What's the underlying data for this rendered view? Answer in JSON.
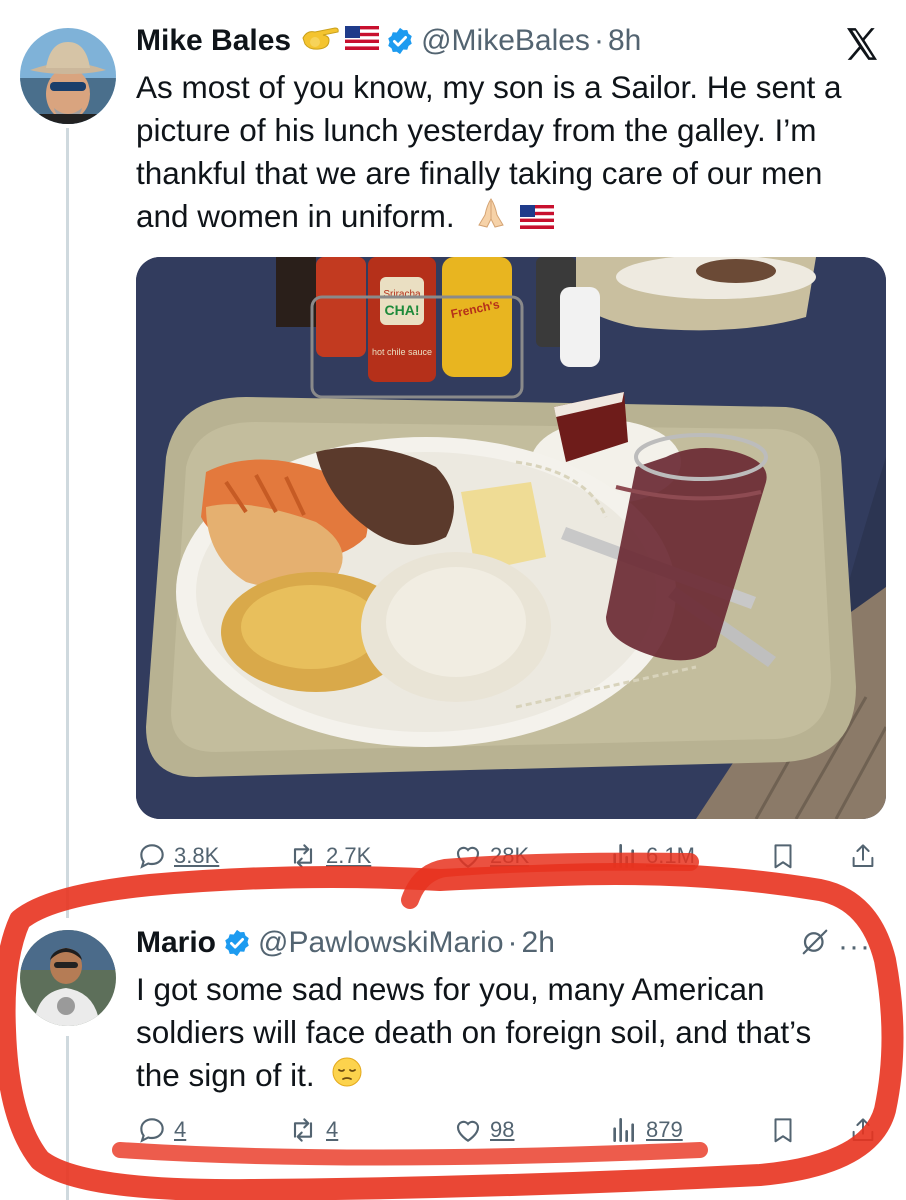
{
  "tweet1": {
    "name": "Mike Bales",
    "handle": "@MikeBales",
    "separator": "·",
    "time": "8h",
    "text_lines": [
      "As most of you know, my son is a Sailor. He sent a",
      "picture of his lunch yesterday from the galley. I’m",
      "thankful that we are finally taking care of our men",
      "and women in uniform."
    ],
    "badges": [
      "pointing-hand-icon",
      "us-flag-icon",
      "verified-icon"
    ],
    "trailing_emojis": [
      "folded-hands-icon",
      "us-flag-icon"
    ],
    "media": {
      "bottle_labels": [
        "Sriracha",
        "CHA!",
        "hot chile sauce",
        "French's"
      ]
    },
    "stats": {
      "replies": "3.8K",
      "reposts": "2.7K",
      "likes": "28K",
      "views": "6.1M"
    }
  },
  "tweet2": {
    "name": "Mario",
    "handle": "@PawlowskiMario",
    "separator": "·",
    "time": "2h",
    "text_lines": [
      "I got some sad news for you, many American",
      "soldiers will face death on foreign soil, and that’s",
      "the sign of it."
    ],
    "trailing_emojis": [
      "pensive-face-icon"
    ],
    "more_label": "···",
    "stats": {
      "replies": "4",
      "reposts": "4",
      "likes": "98",
      "views": "879"
    }
  },
  "colors": {
    "text": "#0f1419",
    "secondary": "#536471",
    "verified": "#1d9bf0",
    "highlight": "#e8331f",
    "thread_line": "#cfd9de"
  }
}
